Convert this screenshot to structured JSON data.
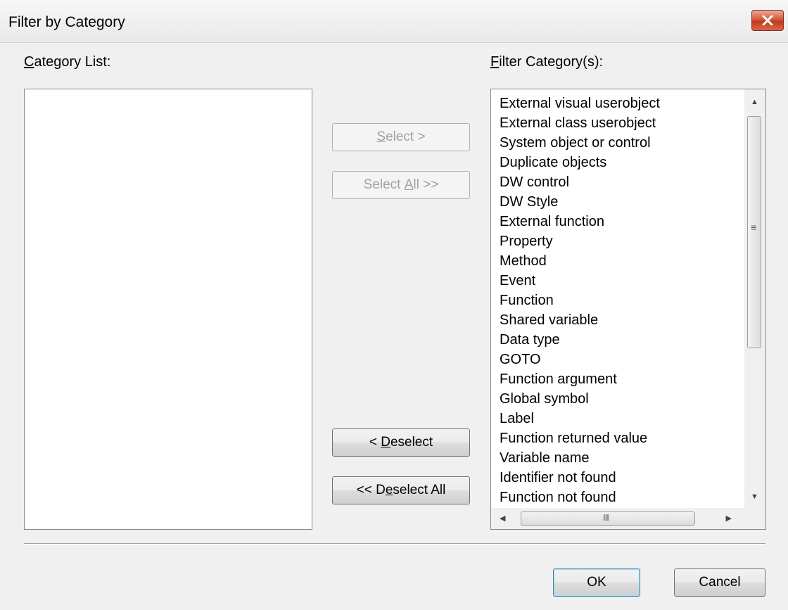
{
  "window": {
    "title": "Filter by Category",
    "close_icon": "close-icon"
  },
  "category_list": {
    "label_accel": "C",
    "label_rest": "ategory List:",
    "items": []
  },
  "filter_list": {
    "label_accel": "F",
    "label_rest": "ilter Category(s):",
    "items": [
      "External visual userobject",
      "External class userobject",
      "System object or control",
      "Duplicate objects",
      "DW control",
      "DW Style",
      "External function",
      "Property",
      "Method",
      "Event",
      "Function",
      "Shared variable",
      "Data type",
      "GOTO",
      "Function argument",
      "Global symbol",
      "Label",
      "Function returned value",
      "Variable name",
      "Identifier not found",
      "Function not found"
    ]
  },
  "buttons": {
    "select": {
      "accel": "S",
      "rest": "elect >",
      "enabled": false
    },
    "select_all": {
      "pre": "Select ",
      "accel": "A",
      "rest": "ll >>",
      "enabled": false
    },
    "deselect": {
      "pre": "< ",
      "accel": "D",
      "rest": "eselect",
      "enabled": true
    },
    "deselect_all": {
      "pre": "<< D",
      "accel": "e",
      "rest": "select All",
      "enabled": true
    },
    "ok": "OK",
    "cancel": "Cancel"
  },
  "scrollbar_icons": {
    "up": "up-arrow-icon",
    "down": "down-arrow-icon",
    "left": "left-arrow-icon",
    "right": "right-arrow-icon"
  }
}
